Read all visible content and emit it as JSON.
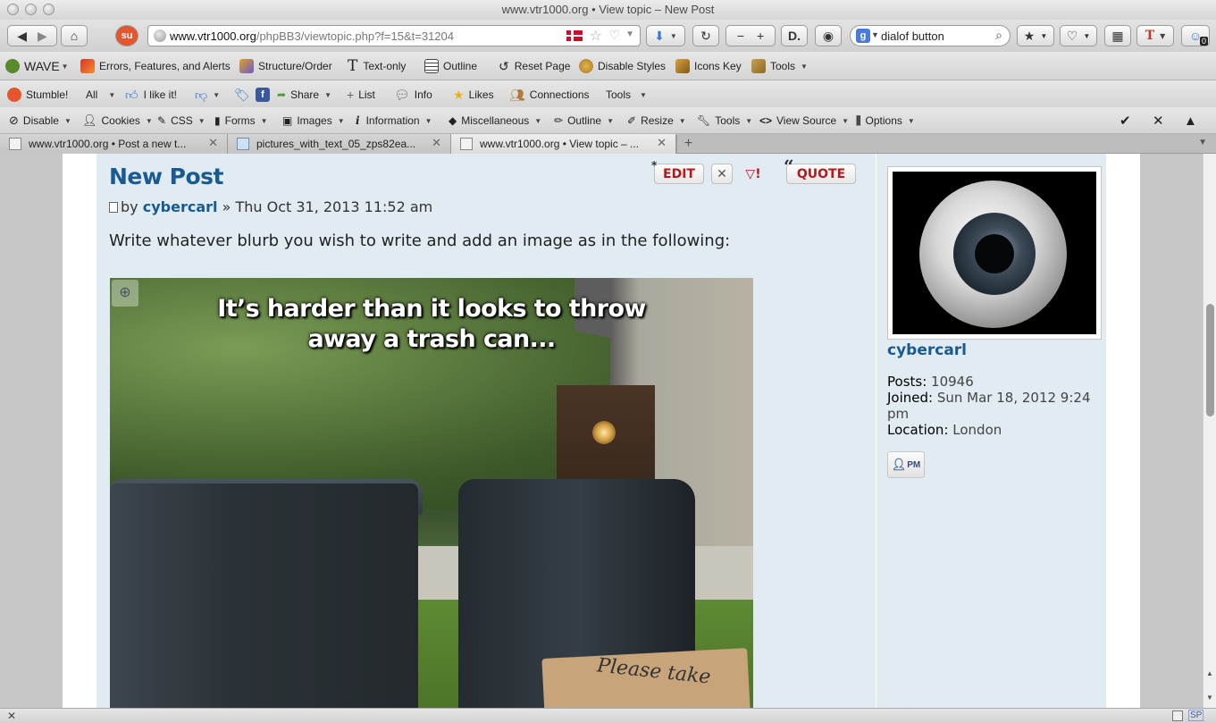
{
  "window": {
    "title": "www.vtr1000.org • View topic – New Post"
  },
  "nav": {
    "url_host": "www.vtr1000.org",
    "url_path": "/phpBB3/viewtopic.php?f=15&t=31204",
    "search_value": "dialof button",
    "addon_badge": "0"
  },
  "wave_toolbar": {
    "items": [
      "WAVE",
      "Errors, Features, and Alerts",
      "Structure/Order",
      "Text-only",
      "Outline",
      "Reset Page",
      "Disable Styles",
      "Icons Key",
      "Tools"
    ]
  },
  "stumble_toolbar": {
    "items": [
      "Stumble!",
      "All",
      "I like it!",
      "Share",
      "List",
      "Info",
      "Likes",
      "Connections",
      "Tools"
    ]
  },
  "webdev_toolbar": {
    "items": [
      "Disable",
      "Cookies",
      "CSS",
      "Forms",
      "Images",
      "Information",
      "Miscellaneous",
      "Outline",
      "Resize",
      "Tools",
      "View Source",
      "Options"
    ]
  },
  "tabs": [
    {
      "title": "www.vtr1000.org • Post a new t..."
    },
    {
      "title": "pictures_with_text_05_zps82ea..."
    },
    {
      "title": "www.vtr1000.org • View topic – ..."
    }
  ],
  "post": {
    "title": "New Post",
    "by": "by",
    "author": "cybercarl",
    "date": "» Thu Oct 31, 2013 11:52 am",
    "body": "Write whatever blurb you wish to write and add an image as in the following:",
    "buttons": {
      "edit": "EDIT",
      "quote": "QUOTE"
    },
    "image_caption_line1": "It’s harder than it looks to throw",
    "image_caption_line2": "away a trash can...",
    "image_sign": "Please take"
  },
  "profile": {
    "username": "cybercarl",
    "posts_label": "Posts:",
    "posts_value": "10946",
    "joined_label": "Joined:",
    "joined_value": "Sun Mar 18, 2012 9:24 pm",
    "location_label": "Location:",
    "location_value": "London",
    "pm_label": "PM"
  },
  "status": {
    "left": "✕",
    "right_a": "SP"
  }
}
